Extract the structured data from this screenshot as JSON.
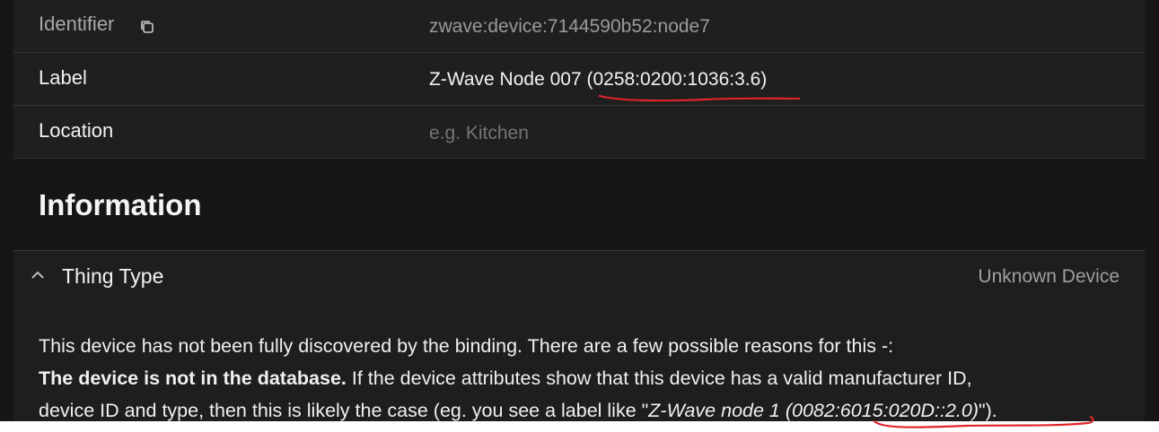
{
  "config_rows": [
    {
      "label": "Identifier",
      "value": "zwave:device:7144590b52:node7"
    },
    {
      "label": "Label",
      "value": "Z-Wave Node 007 (0258:0200:1036:3.6)"
    },
    {
      "label": "Location",
      "placeholder": "e.g. Kitchen"
    }
  ],
  "icons": {
    "copy": "copy-icon",
    "chevron": "chevron-up-icon"
  },
  "information": {
    "title": "Information",
    "thing_type": {
      "title": "Thing Type",
      "value": "Unknown Device",
      "line1": "This device has not been fully discovered by the binding. There are a few possible reasons for this -:",
      "line2_bold": "The device is not in the database.",
      "line2_rest": " If the device attributes show that this device has a valid manufacturer ID,",
      "line3_pre": "device ID and type, then this is likely the case (eg. you see a label like \"",
      "line3_italic": "Z-Wave node 1 (0082:6015:020D::2.0)",
      "line3_post": "\")."
    }
  },
  "annotation_color": "#e0242b"
}
